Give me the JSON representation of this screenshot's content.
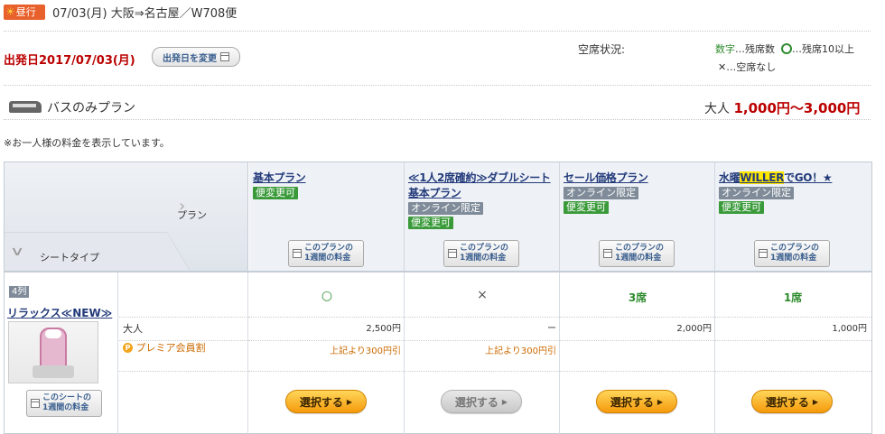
{
  "header": {
    "day_badge": "昼行",
    "route": "07/03(月) 大阪⇒名古屋／W708便",
    "departure": "出発日2017/07/03(月)",
    "change_date_button": "出発日を変更"
  },
  "legend": {
    "title": "空席状況:",
    "digits_word": "数字",
    "digits_desc": "…残席数",
    "circle_desc": "…残席10以上",
    "cross_desc": "✕…空席なし"
  },
  "plan_section": {
    "title": "バスのみプラン",
    "price_prefix": "大人",
    "price_range": "1,000円〜3,000円",
    "note": "※お一人様の料金を表示しています。"
  },
  "table_header": {
    "plan_axis": "プラン",
    "seat_axis": "シートタイプ",
    "week_button_line1": "このプランの",
    "week_button_line2": "1週間の料金"
  },
  "plans": [
    {
      "name": "基本プラン",
      "tags": [
        "便変更可"
      ]
    },
    {
      "name_line1": "≪1人2席確約≫ダブルシート",
      "name_line2": "基本プラン",
      "tags": [
        "オンライン限定",
        "便変更可"
      ]
    },
    {
      "name": "セール価格プラン",
      "tags": [
        "オンライン限定",
        "便変更可"
      ]
    },
    {
      "name_pre": "水曜",
      "name_hl": "WILLER",
      "name_post": "でGO！★",
      "tags": [
        "オンライン限定",
        "便変更可"
      ]
    }
  ],
  "seat_row": {
    "row_tag": "4列",
    "seat_name": "リラックス≪NEW≫",
    "week_button_line1": "このシートの",
    "week_button_line2": "1週間の料金",
    "adult_label": "大人",
    "premium_label": "プレミア会員割",
    "premium_icon": "P",
    "availability": [
      "○",
      "×",
      "3席",
      "1席"
    ],
    "adult_prices": [
      "2,500円",
      "ー",
      "2,000円",
      "1,000円"
    ],
    "premium_discounts": [
      "上記より300円引",
      "上記より300円引",
      "",
      ""
    ],
    "select_label": "選択する",
    "select_enabled": [
      true,
      false,
      true,
      true
    ]
  },
  "colors": {
    "accent_red": "#b00000",
    "available_green": "#2e8b2e",
    "select_orange": "#f59a0c"
  }
}
